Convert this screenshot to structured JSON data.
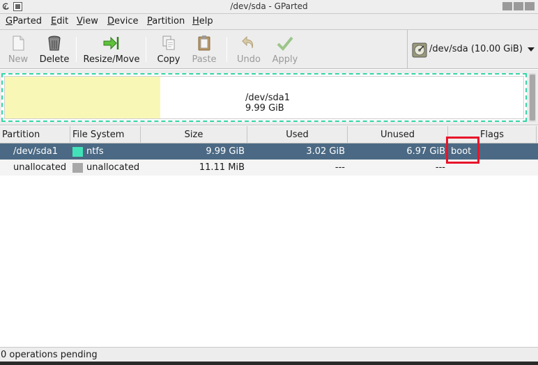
{
  "window": {
    "title": "/dev/sda - GParted"
  },
  "menubar": [
    {
      "label": "GParted",
      "mnemonic": "G",
      "rest": "Parted"
    },
    {
      "label": "Edit",
      "mnemonic": "E",
      "rest": "dit"
    },
    {
      "label": "View",
      "mnemonic": "V",
      "rest": "iew"
    },
    {
      "label": "Device",
      "mnemonic": "D",
      "rest": "evice"
    },
    {
      "label": "Partition",
      "mnemonic": "P",
      "rest": "artition"
    },
    {
      "label": "Help",
      "mnemonic": "H",
      "rest": "elp"
    }
  ],
  "toolbar": {
    "new_label": "New",
    "delete_label": "Delete",
    "resize_label": "Resize/Move",
    "copy_label": "Copy",
    "paste_label": "Paste",
    "undo_label": "Undo",
    "apply_label": "Apply",
    "device_text": "/dev/sda  (10.00 GiB)"
  },
  "disk_map": {
    "partition_name": "/dev/sda1",
    "partition_size": "9.99 GiB",
    "used_fraction": 0.3,
    "colors": {
      "border": "#33d6a6",
      "used": "#f8f7b6"
    }
  },
  "table": {
    "headers": {
      "partition": "Partition",
      "filesystem": "File System",
      "size": "Size",
      "used": "Used",
      "unused": "Unused",
      "flags": "Flags"
    },
    "rows": [
      {
        "partition": "/dev/sda1",
        "filesystem": "ntfs",
        "fs_color": "#42e2b8",
        "size": "9.99 GiB",
        "used": "3.02 GiB",
        "unused": "6.97 GiB",
        "flags": "boot"
      },
      {
        "partition": "unallocated",
        "filesystem": "unallocated",
        "fs_color": "#a8a8a8",
        "size": "11.11 MiB",
        "used": "---",
        "unused": "---",
        "flags": ""
      }
    ]
  },
  "status": {
    "text": "0 operations pending"
  },
  "colors": {
    "selection": "#4b6984",
    "highlight": "#e8152a"
  }
}
